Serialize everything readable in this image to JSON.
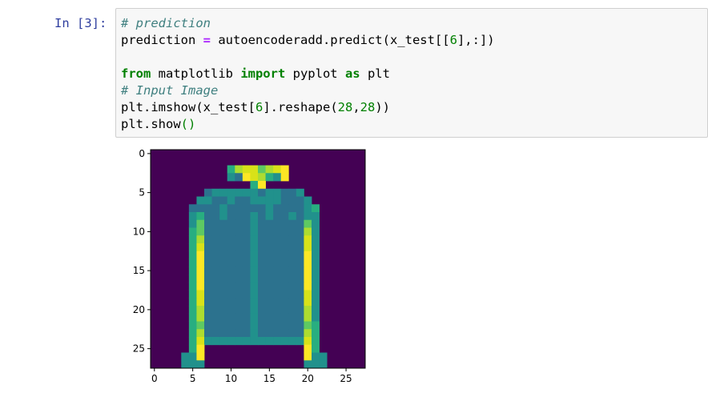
{
  "cell": {
    "prompt": "In [3]:",
    "code_lines": [
      [
        {
          "t": "# prediction",
          "c": "c-comment"
        }
      ],
      [
        {
          "t": "prediction "
        },
        {
          "t": "=",
          "c": "c-op"
        },
        {
          "t": " autoencoderadd.predict(x_test[["
        },
        {
          "t": "6",
          "c": "c-num"
        },
        {
          "t": "],:])"
        }
      ],
      [
        {
          "t": ""
        }
      ],
      [
        {
          "t": "from",
          "c": "c-kw"
        },
        {
          "t": " matplotlib "
        },
        {
          "t": "import",
          "c": "c-kw"
        },
        {
          "t": " pyplot "
        },
        {
          "t": "as",
          "c": "c-kw"
        },
        {
          "t": " plt"
        }
      ],
      [
        {
          "t": "# Input Image",
          "c": "c-comment"
        }
      ],
      [
        {
          "t": "plt.imshow(x_test["
        },
        {
          "t": "6",
          "c": "c-num"
        },
        {
          "t": "].reshape("
        },
        {
          "t": "28",
          "c": "c-num"
        },
        {
          "t": ","
        },
        {
          "t": "28",
          "c": "c-num"
        },
        {
          "t": "))"
        }
      ],
      [
        {
          "t": "plt.show"
        },
        {
          "t": "()",
          "c": "c-num"
        }
      ]
    ]
  },
  "chart_data": {
    "type": "heatmap",
    "colormap": "viridis",
    "rows": 28,
    "cols": 28,
    "x_ticks": [
      0,
      5,
      10,
      15,
      20,
      25
    ],
    "y_ticks": [
      0,
      5,
      10,
      15,
      20,
      25
    ],
    "x_tick_labels": [
      "0",
      "5",
      "10",
      "15",
      "20",
      "25"
    ],
    "y_tick_labels": [
      "0",
      "5",
      "10",
      "15",
      "20",
      "25"
    ],
    "grid": false,
    "values": [
      "0000000000000000000000000000",
      "0000000000000000000000000000",
      "000000000057886789000000000",
      "000000000043987549000000000",
      "000000000000059000000000000",
      "000000034444443443340000000",
      "000000443343344443334000000",
      "000003333433333433334500000",
      "000004533433343433434400000",
      "000004633333343333336400000",
      "000005633333343333337400000",
      "000005733333343333338400000",
      "000005833333343333338400000",
      "000005933333343333339400000",
      "000005933333343333339400000",
      "000005933333343333339400000",
      "000005933333343333339400000",
      "000005933333343333339400000",
      "000005833333343333338400000",
      "000005833333343333338400000",
      "000005733333343333337400000",
      "000005733333343333337400000",
      "000005633333343333336500000",
      "000005733333343333337500000",
      "000005844444444444448500000",
      "000005900000000000009500000",
      "000044900000000000009440000",
      "000044400000000000004440000"
    ]
  }
}
